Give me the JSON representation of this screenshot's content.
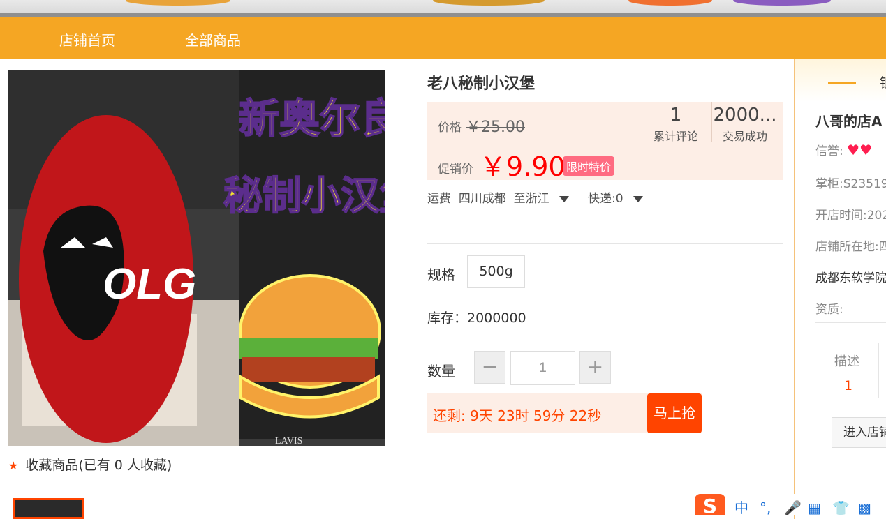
{
  "nav": {
    "items": [
      "店铺首页",
      "全部商品"
    ]
  },
  "product": {
    "title": "老八秘制小汉堡",
    "image_text": {
      "headline_1": "新奥尔良",
      "headline_2": "秘制小汉堡",
      "logo": "OLG",
      "tv_brand": "LAVIS"
    },
    "price_label": "价格",
    "original_price": "￥25.00",
    "promo_label": "促销价",
    "promo_price": "￥9.90",
    "promo_badge": "限时特价",
    "stats": [
      {
        "value": "1",
        "label": "累计评论"
      },
      {
        "value": "2000...",
        "label": "交易成功"
      }
    ],
    "shipping": {
      "label": "运费",
      "from": "四川成都",
      "to": "至浙江",
      "express": "快递:0"
    },
    "spec_label": "规格",
    "spec_option": "500g",
    "stock": "库存：2000000",
    "quantity_label": "数量",
    "quantity_minus": "−",
    "quantity_plus": "+",
    "quantity_value": "1",
    "countdown": "还剩:  9天 23时 59分 22秒",
    "buy_button": "马上抢",
    "favorite": "收藏商品(已有 0 人收藏)"
  },
  "shop": {
    "header_text": "银",
    "name": "八哥的店A",
    "credit_label": "信誉:",
    "credit_hearts": "♥♥",
    "keeper": "掌柜:S23519",
    "open_time": "开店时间:202",
    "location": "店铺所在地:四",
    "address": "成都东软学院",
    "qualification": "资质:",
    "score_label": "描述",
    "score_value": "1",
    "enter_button": "进入店铺"
  },
  "ime": {
    "logo": "S",
    "items": [
      "中",
      "°,",
      "🎤",
      "▦",
      "👕",
      "▩"
    ]
  },
  "colors": {
    "nav": "#f5a623",
    "accent": "#ff4400",
    "promo_price": "#ff0000",
    "badge": "#ff6b81",
    "price_bg": "#fdeee6"
  }
}
